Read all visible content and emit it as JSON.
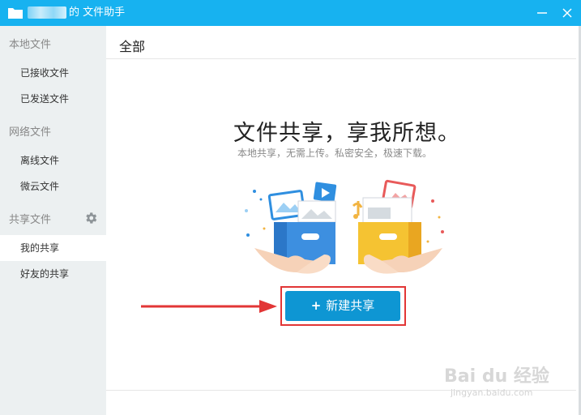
{
  "window": {
    "title": "的 文件助手",
    "accent": "#17b2f0"
  },
  "sidebar": {
    "sections": [
      {
        "header": "本地文件",
        "items": [
          "已接收文件",
          "已发送文件"
        ]
      },
      {
        "header": "网络文件",
        "items": [
          "离线文件",
          "微云文件"
        ]
      },
      {
        "header": "共享文件",
        "items": [
          "我的共享",
          "好友的共享"
        ]
      }
    ],
    "active_item": "我的共享",
    "settings_icon": "gear-icon"
  },
  "main": {
    "tab_title": "全部",
    "hero_title": "文件共享，享我所想。",
    "hero_subtitle": "本地共享，无需上传。私密安全，极速下载。",
    "new_share_button": "新建共享",
    "button_color": "#0e96d3",
    "highlight_color": "#e23636"
  },
  "watermark": {
    "main": "Bai du 经验",
    "sub": "jingyan.baidu.com"
  }
}
